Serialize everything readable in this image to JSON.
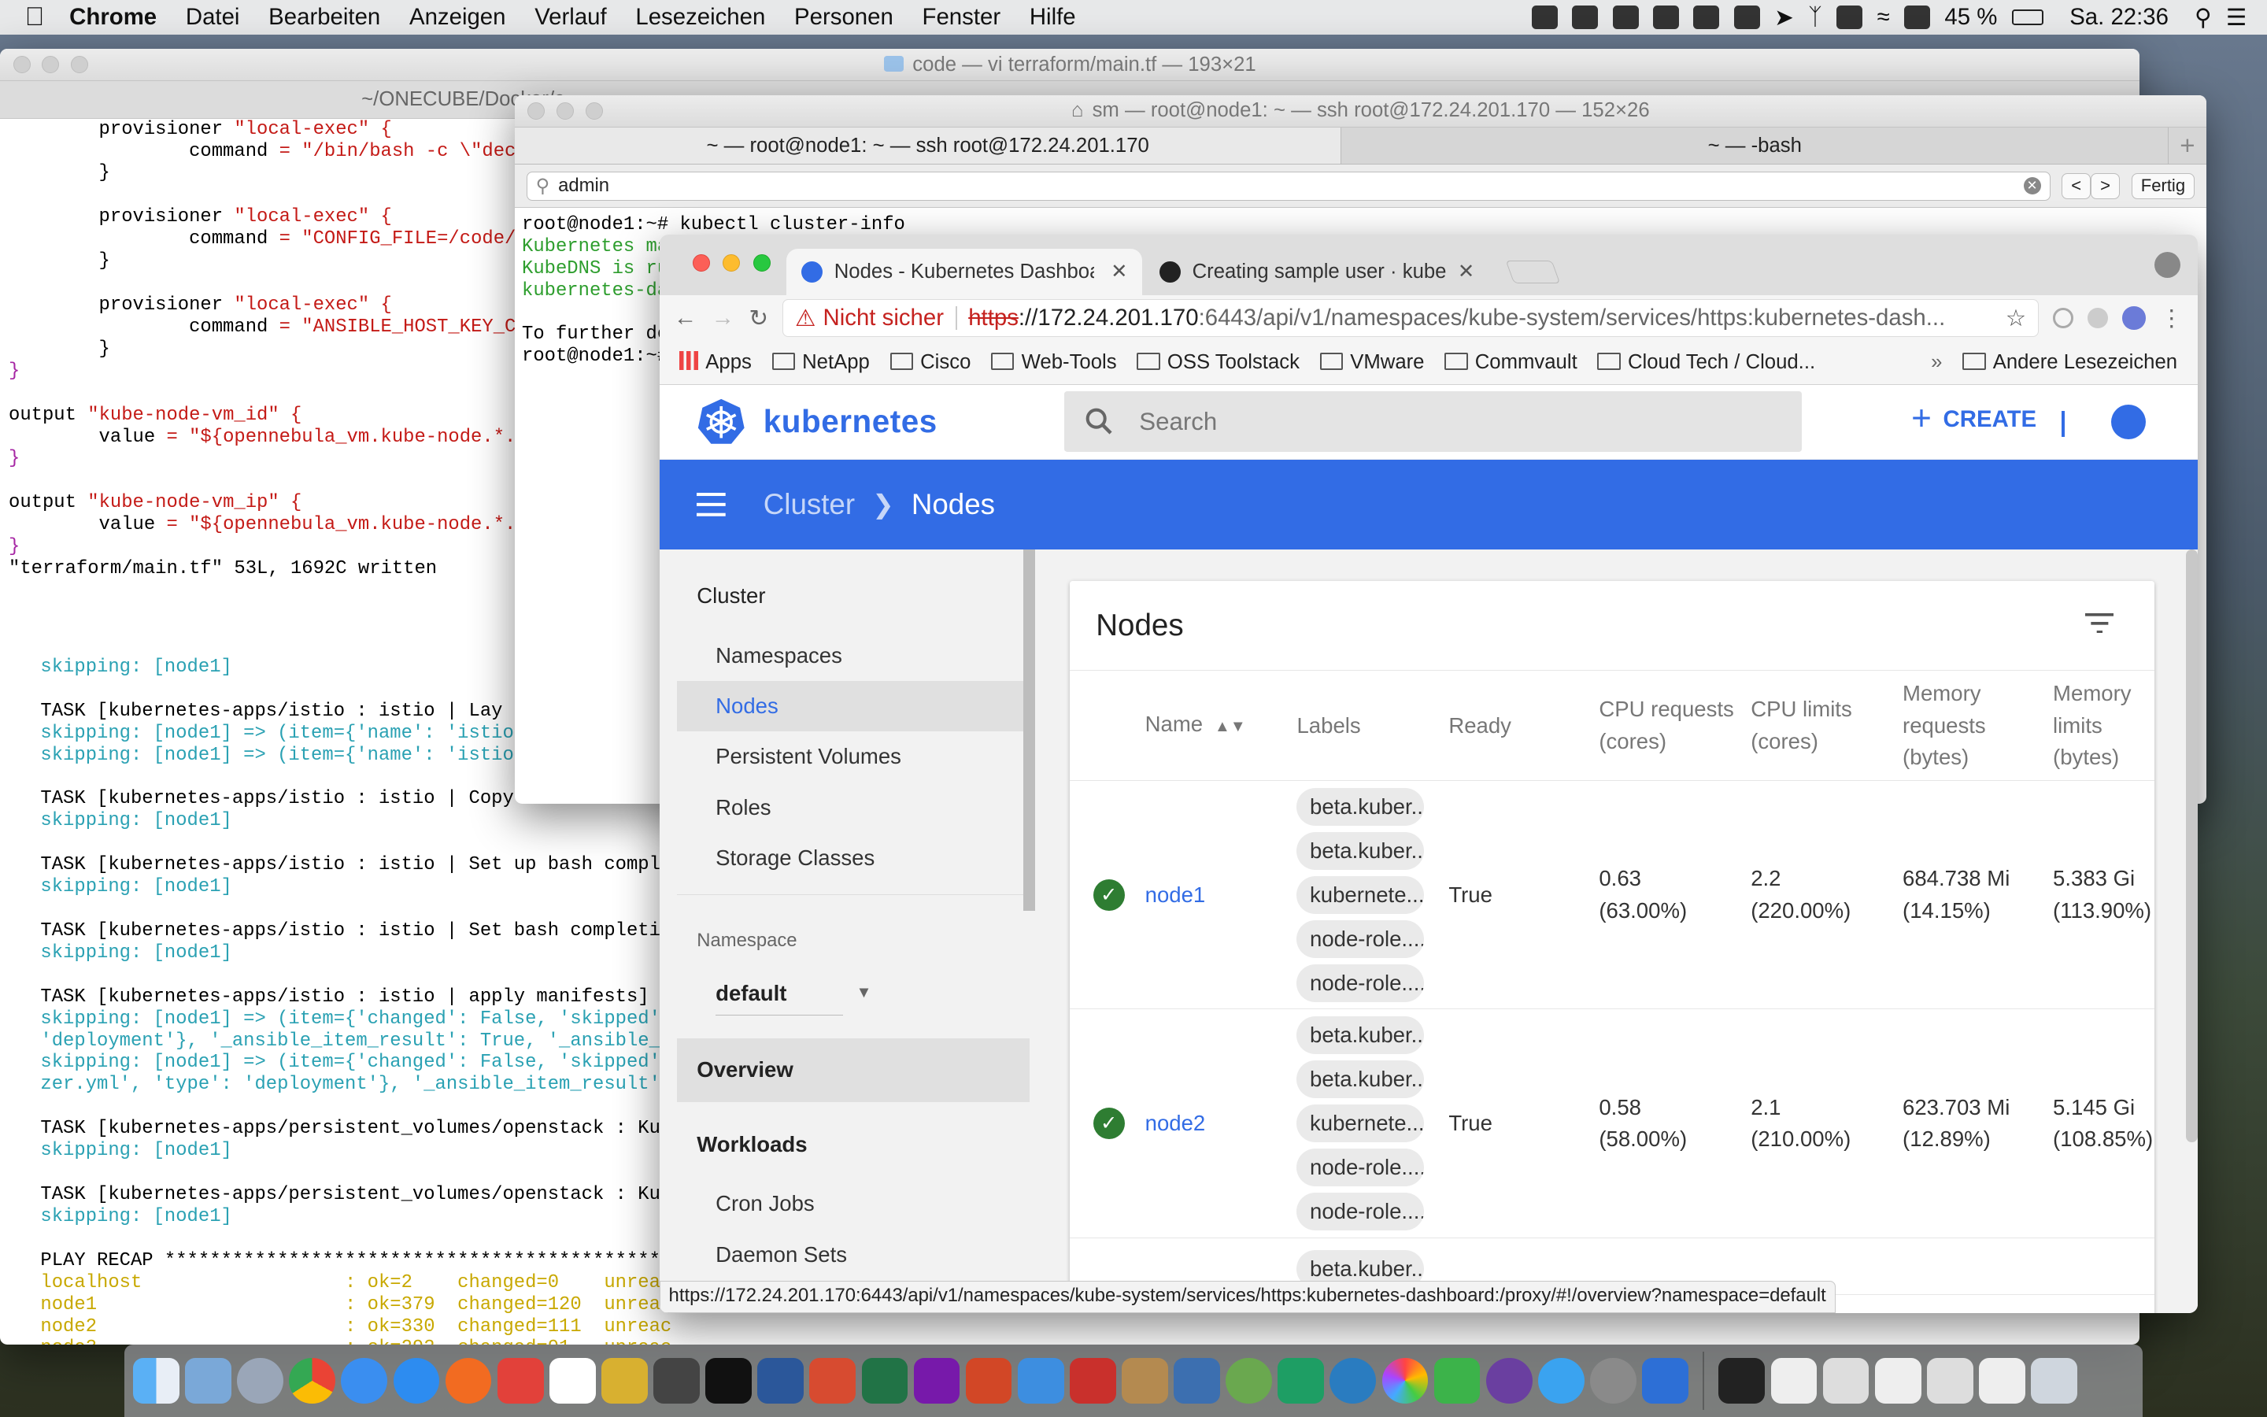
{
  "menubar": {
    "app": "Chrome",
    "menus": [
      "Datei",
      "Bearbeiten",
      "Anzeigen",
      "Verlauf",
      "Lesezeichen",
      "Personen",
      "Fenster",
      "Hilfe"
    ],
    "battery": "45 %",
    "clock": "Sa. 22:36"
  },
  "code_window": {
    "title": "code — vi terraform/main.tf — 193×21",
    "tab": "~/ONECUBE/Docker/c",
    "lines": [
      "        provisioner \"local-exec\" {",
      "                command = \"/bin/bash -c \\\"decl",
      "        }",
      "",
      "        provisioner \"local-exec\" {",
      "                command = \"CONFIG_FILE=/code/k",
      "        }",
      "",
      "        provisioner \"local-exec\" {",
      "                command = \"ANSIBLE_HOST_KEY_CH",
      "        }",
      "}",
      "",
      "output \"kube-node-vm_id\" {",
      "        value = \"${opennebula_vm.kube-node.*.i",
      "}",
      "",
      "output \"kube-node-vm_ip\" {",
      "        value = \"${opennebula_vm.kube-node.*.i",
      "}",
      "\"terraform/main.tf\" 53L, 1692C written"
    ],
    "ansible_lines": [
      "skipping: [node1]",
      "",
      "TASK [kubernetes-apps/istio : istio | Lay o",
      "skipping: [node1] => (item={'name': 'istio-",
      "skipping: [node1] => (item={'name': 'istio-",
      "",
      "TASK [kubernetes-apps/istio : istio | Copy",
      "skipping: [node1]",
      "",
      "TASK [kubernetes-apps/istio : istio | Set up bash comple",
      "skipping: [node1]",
      "",
      "TASK [kubernetes-apps/istio : istio | Set bash completio",
      "skipping: [node1]",
      "",
      "TASK [kubernetes-apps/istio : istio | apply manifests] *",
      "skipping: [node1] => (item={'changed': False, 'skipped'",
      "'deployment'}, '_ansible_item_result': True, '_ansible_i",
      "skipping: [node1] => (item={'changed': False, 'skipped'",
      "zer.yml', 'type': 'deployment'}, '_ansible_item_result'",
      "",
      "TASK [kubernetes-apps/persistent_volumes/openstack : Kub",
      "skipping: [node1]",
      "",
      "TASK [kubernetes-apps/persistent_volumes/openstack : Kub",
      "skipping: [node1]",
      "",
      "PLAY RECAP *********************************************",
      "localhost                  : ok=2    changed=0    unreac",
      "node1                      : ok=379  changed=120  unreac",
      "node2                      : ok=330  changed=111  unreac",
      "node3                      : ok=292  changed=91   unreac"
    ]
  },
  "ssh_window": {
    "title": "sm — root@node1: ~ — ssh root@172.24.201.170 — 152×26",
    "tabs": [
      "~ — root@node1: ~ — ssh root@172.24.201.170",
      "~ — -bash"
    ],
    "find_value": "admin",
    "find_done": "Fertig",
    "lines": [
      "root@node1:~# kubectl cluster-info",
      "Kubernetes ma",
      "KubeDNS is ru",
      "kubernetes-da",
      "",
      "To further de",
      "root@node1:~#"
    ]
  },
  "chrome": {
    "tabs": [
      {
        "title": "Nodes - Kubernetes Dashboard"
      },
      {
        "title": "Creating sample user · kubernetes"
      }
    ],
    "security": "Nicht sicher",
    "url_scheme": "https",
    "url_host": "://172.24.201.170",
    "url_path": ":6443/api/v1/namespaces/kube-system/services/https:kubernetes-dash...",
    "bookmarks": [
      "Apps",
      "NetApp",
      "Cisco",
      "Web-Tools",
      "OSS Toolstack",
      "VMware",
      "Commvault",
      "Cloud Tech / Cloud...",
      "Andere Lesezeichen"
    ],
    "status_url": "https://172.24.201.170:6443/api/v1/namespaces/kube-system/services/https:kubernetes-dashboard:/proxy/#!/overview?namespace=default"
  },
  "dashboard": {
    "brand": "kubernetes",
    "search_placeholder": "Search",
    "create_label": "CREATE",
    "breadcrumb_parent": "Cluster",
    "breadcrumb_current": "Nodes",
    "nav": {
      "cluster_header": "Cluster",
      "cluster_items": [
        "Namespaces",
        "Nodes",
        "Persistent Volumes",
        "Roles",
        "Storage Classes"
      ],
      "namespace_label": "Namespace",
      "namespace_value": "default",
      "overview": "Overview",
      "workloads": "Workloads",
      "workload_items": [
        "Cron Jobs",
        "Daemon Sets"
      ]
    },
    "card_title": "Nodes",
    "columns": {
      "name": "Name",
      "labels": "Labels",
      "ready": "Ready",
      "cpu_req": "CPU requests (cores)",
      "cpu_lim": "CPU limits (cores)",
      "mem_req": "Memory requests (bytes)",
      "mem_lim": "Memory limits (bytes)"
    },
    "rows": [
      {
        "name": "node1",
        "labels": [
          "beta.kuber...",
          "beta.kuber...",
          "kubernete...",
          "node-role....",
          "node-role...."
        ],
        "ready": "True",
        "cpu_req": "0.63",
        "cpu_req_pct": "(63.00%)",
        "cpu_lim": "2.2",
        "cpu_lim_pct": "(220.00%)",
        "mem_req": "684.738 Mi",
        "mem_req_pct": "(14.15%)",
        "mem_lim": "5.383 Gi",
        "mem_lim_pct": "(113.90%)"
      },
      {
        "name": "node2",
        "labels": [
          "beta.kuber...",
          "beta.kuber...",
          "kubernete...",
          "node-role....",
          "node-role...."
        ],
        "ready": "True",
        "cpu_req": "0.58",
        "cpu_req_pct": "(58.00%)",
        "cpu_lim": "2.1",
        "cpu_lim_pct": "(210.00%)",
        "mem_req": "623.703 Mi",
        "mem_req_pct": "(12.89%)",
        "mem_lim": "5.145 Gi",
        "mem_lim_pct": "(108.85%)"
      }
    ],
    "row3_first_label": "beta.kuber..."
  }
}
